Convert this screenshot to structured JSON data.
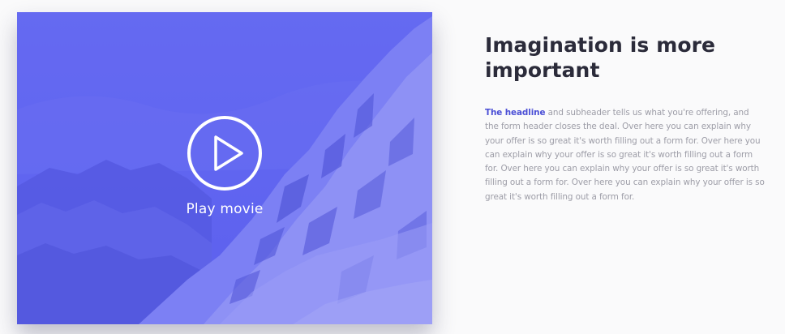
{
  "video": {
    "play_label": "Play movie",
    "overlay_color": "#5a5ff0"
  },
  "content": {
    "headline": "Imagination is more important",
    "body_lead": "The headline",
    "body_text": " and subheader tells us what you're offering, and the form header closes the deal. Over here you can explain why your offer is so great it's worth filling out a form for. Over here you can explain why your offer is so great it's worth filling out a form for. Over here you can explain why your offer is so great it's worth filling out a form for. Over here you can explain why your offer is so great it's worth filling out a form for.",
    "accent_color": "#4b4fd6"
  },
  "icons": {
    "play": "play-circle-icon"
  }
}
